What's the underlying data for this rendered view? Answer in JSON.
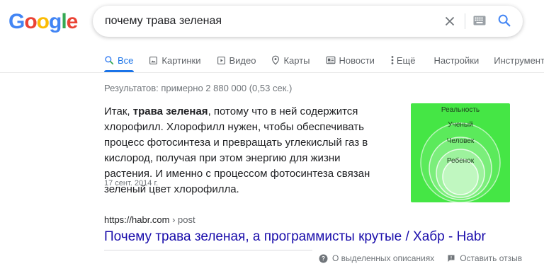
{
  "logo": {
    "letters": [
      "G",
      "o",
      "o",
      "g",
      "l",
      "e"
    ],
    "colors": [
      "#4285f4",
      "#ea4335",
      "#fbbc05",
      "#4285f4",
      "#34a853",
      "#ea4335"
    ]
  },
  "search": {
    "query": "почему трава зеленая"
  },
  "tabs": [
    {
      "label": "Все",
      "icon": "search-icon",
      "active": true
    },
    {
      "label": "Картинки",
      "icon": "image-icon"
    },
    {
      "label": "Видео",
      "icon": "video-icon"
    },
    {
      "label": "Карты",
      "icon": "map-pin-icon"
    },
    {
      "label": "Новости",
      "icon": "news-icon"
    },
    {
      "label": "Ещё",
      "icon": "more-vert-icon"
    },
    {
      "label": "Настройки"
    },
    {
      "label": "Инструменты"
    }
  ],
  "stats": "Результатов: примерно 2 880 000 (0,53 сек.)",
  "featured": {
    "prefix": "Итак, ",
    "bold": "трава зеленая",
    "rest": ", потому что в ней содержится хлорофилл. Хлорофилл нужен, чтобы обеспечивать процесс фотосинтеза и превращать углекислый газ в кислород, получая при этом энергию для жизни растения. И именно с процессом фотосинтеза связан зеленый цвет хлорофилла.",
    "date": "17 сент. 2014 г."
  },
  "diagram": {
    "labels": [
      "Реальность",
      "Ученый",
      "Человек",
      "Ребенок"
    ],
    "background": "#45e645"
  },
  "result": {
    "domain": "https://habr.com",
    "path": " › post",
    "title": "Почему трава зеленая, а программисты крутые / Хабр - Habr"
  },
  "footer": {
    "about": "О выделенных описаниях",
    "feedback": "Оставить отзыв"
  },
  "colors": {
    "link": "#1a0dab",
    "accent": "#1a73e8"
  }
}
